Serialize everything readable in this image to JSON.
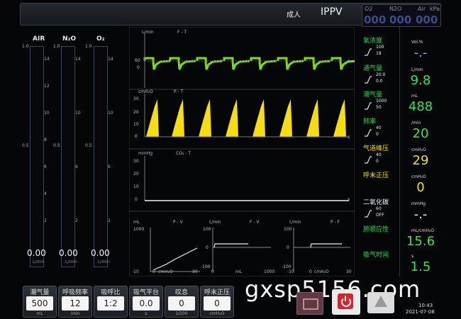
{
  "header": {
    "patient_type": "成人",
    "mode": "IPPV",
    "gas_supply": [
      {
        "label": "O2",
        "value": "000"
      },
      {
        "label": "N2O",
        "value": "000"
      },
      {
        "label": "Air",
        "value": "000"
      }
    ],
    "gas_unit": "kPa"
  },
  "flowmeter": {
    "tubes": [
      {
        "label": "AIR",
        "value": "0.00",
        "unit": "L/min"
      },
      {
        "label": "N₂O",
        "value": "0.00",
        "unit": "L/min"
      },
      {
        "label": "O₂",
        "value": "0.00",
        "unit": "L/min"
      }
    ],
    "left_scale": [
      "1.0",
      "0.5",
      "0"
    ],
    "right_scale": [
      "14",
      "12",
      "10",
      "8",
      "6",
      "4",
      "2"
    ]
  },
  "waveforms": {
    "flow": {
      "unit": "L/min",
      "title": "F - T",
      "y_top": "60",
      "y_zero": "0",
      "x_end": "s"
    },
    "pressure": {
      "unit": "cmH₂O",
      "title": "P - T",
      "y_ticks": [
        "30",
        "20",
        "10",
        "0"
      ],
      "x_end": "s"
    },
    "co2": {
      "unit": "mmHg",
      "title": "CO₂ - T",
      "y_ticks": [
        "30",
        "20",
        "10",
        "0"
      ],
      "x_end": "s"
    },
    "loops": [
      {
        "yunit": "mL",
        "title": "P - V",
        "ymax": "1000",
        "xmin": "-10",
        "xmid": "0",
        "xmax": "30",
        "xunit": "cmH₂O"
      },
      {
        "yunit": "L/min",
        "title": "F - V",
        "ymax": "100",
        "ymid": "0",
        "ymin": "-100",
        "xmin": "0",
        "xmax": "1000",
        "xunit": "mL"
      },
      {
        "yunit": "L/min",
        "title": "P - F",
        "ymax": "100",
        "ymid": "0",
        "ymin": "-100",
        "xmin": "-10",
        "xmid": "0",
        "xmax": "30",
        "xunit": "cmH₂O"
      }
    ]
  },
  "parameters": [
    {
      "label": "氧浓度",
      "range_hi": "100",
      "range_lo": "18",
      "unit": "Vol.%",
      "value": "-.-",
      "color": "#6fb8ff"
    },
    {
      "label": "通气量",
      "range_hi": "20.0",
      "range_lo": "0.0",
      "unit": "L/min",
      "value": "9.8",
      "color": "#33e64d"
    },
    {
      "label": "潮气量",
      "range_hi": "1000",
      "range_lo": "50",
      "unit": "mL",
      "value": "488",
      "color": "#33e64d"
    },
    {
      "label": "频率",
      "range_hi": "40",
      "range_lo": "0",
      "unit": "/min",
      "value": "20",
      "color": "#33e64d"
    },
    {
      "label": "气道峰压",
      "range_hi": "40",
      "range_lo": "0",
      "unit": "cmH₂O",
      "value": "29",
      "color": "#f0e018"
    },
    {
      "label": "呼末正压",
      "range_hi": "",
      "range_lo": "",
      "unit": "cmH₂O",
      "value": "0",
      "color": "#f0e018"
    },
    {
      "label": "二氧化碳",
      "range_hi": "60",
      "range_lo": "OFF",
      "unit": "mmHg",
      "value": "-.-",
      "color": "#f2f2f2"
    },
    {
      "label": "肺顺应性",
      "range_hi": "",
      "range_lo": "",
      "unit": "mL/cmH₂O",
      "value": "15.6",
      "color": "#33e64d"
    },
    {
      "label": "吸气时间",
      "range_hi": "",
      "range_lo": "",
      "unit": "s",
      "value": "1.5",
      "color": "#33e64d"
    }
  ],
  "settings": [
    {
      "label": "潮气量",
      "value": "500",
      "unit": "mL"
    },
    {
      "label": "呼吸频率",
      "value": "12",
      "unit": "/min"
    },
    {
      "label": "吸呼比",
      "value": "1:2",
      "unit": ""
    },
    {
      "label": "吸气平台",
      "value": "0.0",
      "unit": "s"
    },
    {
      "label": "叹息",
      "value": "0",
      "unit": "1/100"
    },
    {
      "label": "呼末正压",
      "value": "0",
      "unit": "cmH₂O"
    }
  ],
  "status": {
    "time": "10:43",
    "date": "2021-07-08"
  },
  "watermark": "gxsp5156.com",
  "colors": {
    "flow": "#7fe000",
    "pressure": "#f5dd10",
    "param_green": "#33e64d"
  }
}
